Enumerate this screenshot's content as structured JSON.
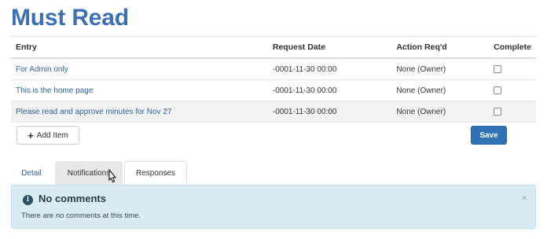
{
  "page": {
    "title": "Must Read"
  },
  "table": {
    "headers": {
      "entry": "Entry",
      "request_date": "Request Date",
      "action": "Action Req'd",
      "complete": "Complete"
    },
    "rows": [
      {
        "entry": "For Admin only",
        "request_date": "-0001-11-30 00:00",
        "action": "None (Owner)",
        "complete": false
      },
      {
        "entry": "This is the home page",
        "request_date": "-0001-11-30 00:00",
        "action": "None (Owner)",
        "complete": false
      },
      {
        "entry": "Please read and approve minutes for Nov 27",
        "request_date": "-0001-11-30 00:00",
        "action": "None (Owner)",
        "complete": false
      }
    ]
  },
  "buttons": {
    "add_item": "Add Item",
    "save": "Save"
  },
  "tabs": {
    "detail": "Detail",
    "notifications": "Notifications",
    "responses": "Responses",
    "active": "Responses"
  },
  "alert": {
    "heading": "No comments",
    "body": "There are no comments at this time.",
    "close": "×"
  },
  "colors": {
    "title": "#3d6fb4",
    "link": "#2f5f9e",
    "save_button": "#2f71b5",
    "alert_background": "#d8ecf3"
  }
}
